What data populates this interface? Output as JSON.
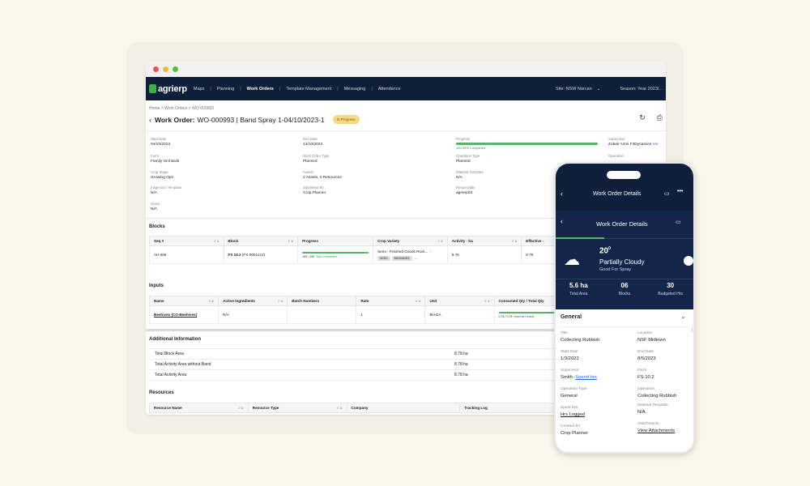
{
  "nav": {
    "logo": "agrierp",
    "items": [
      "Maps",
      "Planning",
      "Work Orders",
      "Template Management",
      "Messaging",
      "Attendance"
    ],
    "site": "Site: NSW Narcan",
    "season": "Season: Year 2023/..."
  },
  "breadcrumb": "Home > Work Orders > WO-000993",
  "header": {
    "prefix": "Work Order:",
    "title": "WO-000993 | Band Spray 1-04/10/2023-1",
    "status": "In Progress"
  },
  "details": {
    "start_date_label": "Start Date",
    "start_date": "04/10/2023",
    "end_date_label": "End Date",
    "end_date": "14/10/2023",
    "progress_label": "Progress",
    "progress_text": "100.00% Completed",
    "progress_value": 1.0,
    "supervisor_label": "Supervisor",
    "supervisor": "Zubair Azmi F3Dynamics",
    "supervisor_link": "Vie",
    "farm_label": "Farm",
    "farm": "Family Orchards",
    "wo_type_label": "Work Order Type",
    "wo_type": "Planned",
    "op_type_label": "Operation Type",
    "op_type": "Planned",
    "operation_label": "Operation",
    "crop_stage_label": "Crop Stage",
    "crop_stage": "Growing Ops",
    "assets_label": "Assets",
    "assets": "2 Assets, 4 Resources",
    "material_template_label": "Material Template",
    "material_template": "N/A",
    "inspection_label": "Inspection Template",
    "inspection": "N/A",
    "submitted_label": "Submitted By",
    "submitted": "Crop Planner",
    "responsible_label": "Responsible",
    "responsible": "agrierp02",
    "notes_label": "Notes",
    "notes": "N/A"
  },
  "blocks": {
    "title": "Blocks",
    "columns": [
      "Seq #",
      "Block",
      "Progress",
      "Crop Variety",
      "Activity - ha",
      "Effective - "
    ],
    "row": {
      "seq": "AH 656",
      "block_bold": "FS 10.2",
      "block_rest": "(FS-0001212)",
      "progress_text": "100 / 100",
      "progress_link": "Sets Completed",
      "progress_value": 1.0,
      "variety": "Semi - Finished Goods Rock...",
      "chips": [
        "SEED",
        "BASKADES"
      ],
      "activity": "8.78",
      "effective": "8.78"
    }
  },
  "inputs": {
    "title": "Inputs",
    "columns": [
      "Name",
      "Active Ingredients",
      "Batch Numbers",
      "Rate",
      "Unit",
      "Consumed Qty / Total Qty"
    ],
    "row": {
      "name": "Beehives (CO-Beehives)",
      "ingredients": "N/A",
      "batch": "",
      "rate": "1",
      "unit": "BH-EA",
      "consumed": "0.78 / 0.78",
      "consumed_link": "Material Details",
      "progress_value": 1.0
    }
  },
  "additional": {
    "title": "Additional Information",
    "rows": [
      {
        "label": "Total Block Area",
        "value": "8.78 ha"
      },
      {
        "label": "Total Activity Area without Band",
        "value": "8.78 ha"
      },
      {
        "label": "Total Activity Area",
        "value": "8.78 ha"
      }
    ]
  },
  "resources": {
    "title": "Resources",
    "columns": [
      "Resource Name",
      "Resource Type",
      "Company",
      "Tracking Log"
    ]
  },
  "phone": {
    "top_title": "Work Order Details",
    "mid_title": "Work Order Details",
    "temp": "20",
    "deg": "0",
    "weather": "Partially Cloudy",
    "weather_sub": "Good For Spray",
    "stats": [
      {
        "value": "5.6 ha",
        "label": "Total Area"
      },
      {
        "value": "06",
        "label": "Blocks"
      },
      {
        "value": "30",
        "label": "Budgeted Hrs"
      }
    ],
    "general": "General",
    "fields": [
      {
        "label": "Title",
        "value": "Collecting Rubbish"
      },
      {
        "label": "Location",
        "value": "NSF Midtown"
      },
      {
        "label": "Start Date",
        "value": "1/3/2023"
      },
      {
        "label": "End Date",
        "value": "8/5/2023"
      },
      {
        "label": "Supervisor",
        "value": "Smith -",
        "link": "Spend hrs"
      },
      {
        "label": "Farm",
        "value": "FS-10.2"
      },
      {
        "label": "Operation Type",
        "value": "General"
      },
      {
        "label": "Operation",
        "value": "Collecting Rubbish"
      },
      {
        "label": "Spent Hrs",
        "value": "",
        "link": "Hrs Logged"
      },
      {
        "label": "Material Template",
        "value": "N/A"
      },
      {
        "label": "Created BY",
        "value": "Crop Planner"
      },
      {
        "label": "Attachments",
        "value": "",
        "link": "View Attachments"
      }
    ]
  }
}
